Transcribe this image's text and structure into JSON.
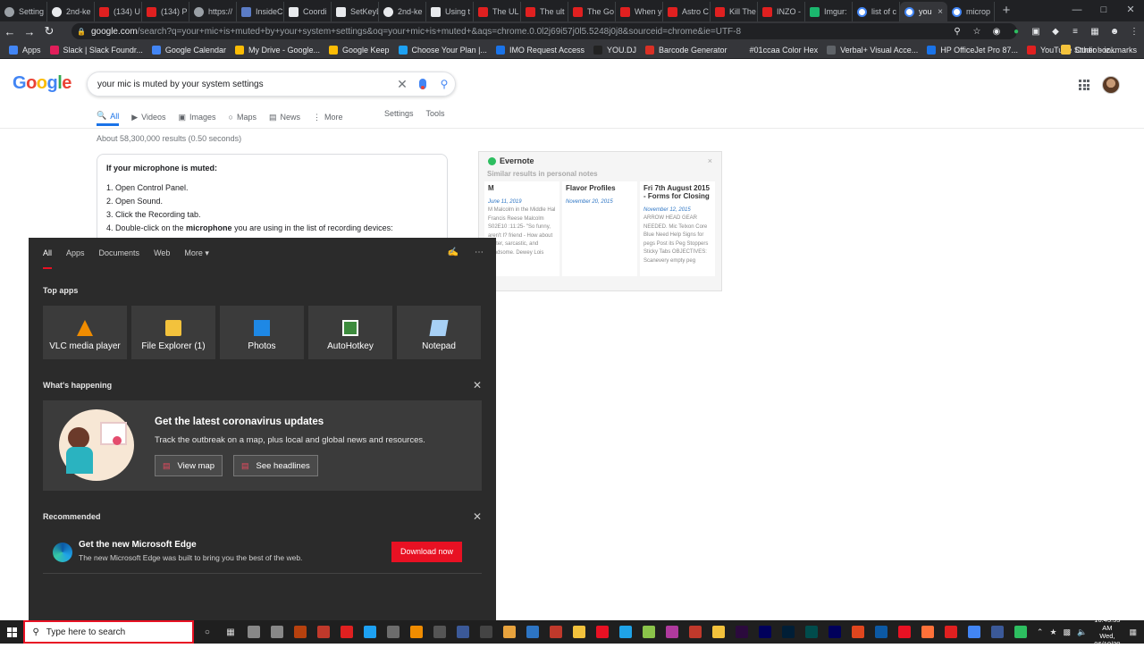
{
  "browser": {
    "tabs": [
      {
        "label": "Setting",
        "fav": "gr"
      },
      {
        "label": "2nd-ke",
        "fav": "gh"
      },
      {
        "label": "(134) U",
        "fav": "yt"
      },
      {
        "label": "(134) P",
        "fav": "yt"
      },
      {
        "label": "https://",
        "fav": "gr"
      },
      {
        "label": "InsideC",
        "fav": "n"
      },
      {
        "label": "Coordi",
        "fav": "a"
      },
      {
        "label": "SetKeyD",
        "fav": "a"
      },
      {
        "label": "2nd-ke",
        "fav": "gh"
      },
      {
        "label": "Using t",
        "fav": "a"
      },
      {
        "label": "The UL",
        "fav": "yt"
      },
      {
        "label": "The ult",
        "fav": "yt"
      },
      {
        "label": "The Go",
        "fav": "yt"
      },
      {
        "label": "When y",
        "fav": "yt"
      },
      {
        "label": "Astro C",
        "fav": "yt"
      },
      {
        "label": "Kill The",
        "fav": "yt"
      },
      {
        "label": "INZO -",
        "fav": "yt"
      },
      {
        "label": "Imgur:",
        "fav": "im"
      },
      {
        "label": "list of c",
        "fav": "g"
      },
      {
        "label": "you",
        "fav": "g",
        "active": true
      },
      {
        "label": "microp",
        "fav": "g"
      }
    ],
    "new_tab": "+",
    "url_host": "google.com",
    "url_rest": "/search?q=your+mic+is+muted+by+your+system+settings&oq=your+mic+is+muted+&aqs=chrome.0.0l2j69i57j0l5.5248j0j8&sourceid=chrome&ie=UTF-8",
    "bookmarks": [
      {
        "label": "Apps",
        "color": "#4285f4"
      },
      {
        "label": "Slack | Slack Foundr...",
        "color": "#e01e5a"
      },
      {
        "label": "Google Calendar",
        "color": "#4285f4"
      },
      {
        "label": "My Drive - Google...",
        "color": "#fbbc05"
      },
      {
        "label": "Google Keep",
        "color": "#fbbc05"
      },
      {
        "label": "Choose Your Plan |...",
        "color": "#1da1f2"
      },
      {
        "label": "IMO Request Access",
        "color": "#1a73e8"
      },
      {
        "label": "YOU.DJ",
        "color": "#222222"
      },
      {
        "label": "Barcode Generator",
        "color": "#d93025"
      },
      {
        "label": "#01ccaa Color Hex",
        "color": "#35363a"
      },
      {
        "label": "Verbal+ Visual Acce...",
        "color": "#5f6368"
      },
      {
        "label": "HP OfficeJet Pro 87...",
        "color": "#1a73e8"
      },
      {
        "label": "YouTube Studio - iz...",
        "color": "#e02020"
      }
    ],
    "other_bookmarks": "Other bookmarks"
  },
  "google": {
    "query": "your mic is muted by your system settings",
    "tabs": [
      "All",
      "Videos",
      "Images",
      "Maps",
      "News",
      "More"
    ],
    "tab_icons": [
      "🔍",
      "▶",
      "▣",
      "○",
      "▤",
      "⋮"
    ],
    "settings": "Settings",
    "tools": "Tools",
    "stats": "About 58,300,000 results (0.50 seconds)",
    "snippet": {
      "heading": "If your microphone is muted:",
      "steps": [
        "1. Open Control Panel.",
        "2. Open Sound.",
        "3. Click the Recording tab."
      ],
      "step4_pre": "4. Double-click on the ",
      "step4_bold": "microphone",
      "step4_post": " you are using in the list of recording devices:"
    }
  },
  "evernote": {
    "title": "Evernote",
    "close": "×",
    "subtitle": "Similar results in personal notes",
    "notes": [
      {
        "title": "M",
        "date": "June 11, 2019",
        "body": "M Malcolm in the Middle Hal Francis Reese Malcolm S02E10 :11:25- \"So funny, aren't I? friend - How about \"Bitter, sarcastic, and handsome. Dewey Lois"
      },
      {
        "title": "Flavor Profiles",
        "date": "November 20, 2015",
        "body": ""
      },
      {
        "title": "Fri 7th August 2015 - Forms for Closing",
        "date": "November 12, 2015",
        "body": "ARROW HEAD GEAR NEEDED. Mic Telxon Core Blue Need Help Signs for pegs Post its Peg Stoppers Sticky Tabs OBJECTIVES: Scanevery empty peg"
      }
    ]
  },
  "start_menu": {
    "tabs": [
      "All",
      "Apps",
      "Documents",
      "Web",
      "More ▾"
    ],
    "top_apps_label": "Top apps",
    "top_apps": [
      {
        "label": "VLC media player",
        "icon": "vlc"
      },
      {
        "label": "File Explorer (1)",
        "icon": "fe"
      },
      {
        "label": "Photos",
        "icon": "ph"
      },
      {
        "label": "AutoHotkey",
        "icon": "ah"
      },
      {
        "label": "Notepad",
        "icon": "np"
      }
    ],
    "happening_label": "What's happening",
    "news_title": "Get the latest coronavirus updates",
    "news_desc": "Track the outbreak on a map, plus local and global news and resources.",
    "view_map": "View map",
    "see_headlines": "See headlines",
    "recommended_label": "Recommended",
    "edge_title": "Get the new Microsoft Edge",
    "edge_desc": "The new Microsoft Edge was built to bring you the best of the web.",
    "download": "Download now"
  },
  "taskbar": {
    "search_placeholder": "Type here to search",
    "time": "10:43:55 AM",
    "date": "Wed, 06/10/20",
    "pinned_colors": [
      "#888888",
      "#888888",
      "#b7410e",
      "#c0392b",
      "#e02020",
      "#1da1f2",
      "#6c6c6c",
      "#f08c00",
      "#555555",
      "#3b5998",
      "#444444",
      "#e8a33d",
      "#2d75c4",
      "#c0392b",
      "#f3c23c",
      "#e81123",
      "#1fa3e8",
      "#8bc34a",
      "#b03a9e",
      "#c0392b",
      "#f3c23c",
      "#2b0a3d",
      "#00005b",
      "#001e36",
      "#004c4c",
      "#00005b",
      "#e0461e",
      "#0c59a4",
      "#e81123",
      "#ff7139",
      "#e02020",
      "#4285f4",
      "#3b5998",
      "#2dbe60"
    ]
  }
}
